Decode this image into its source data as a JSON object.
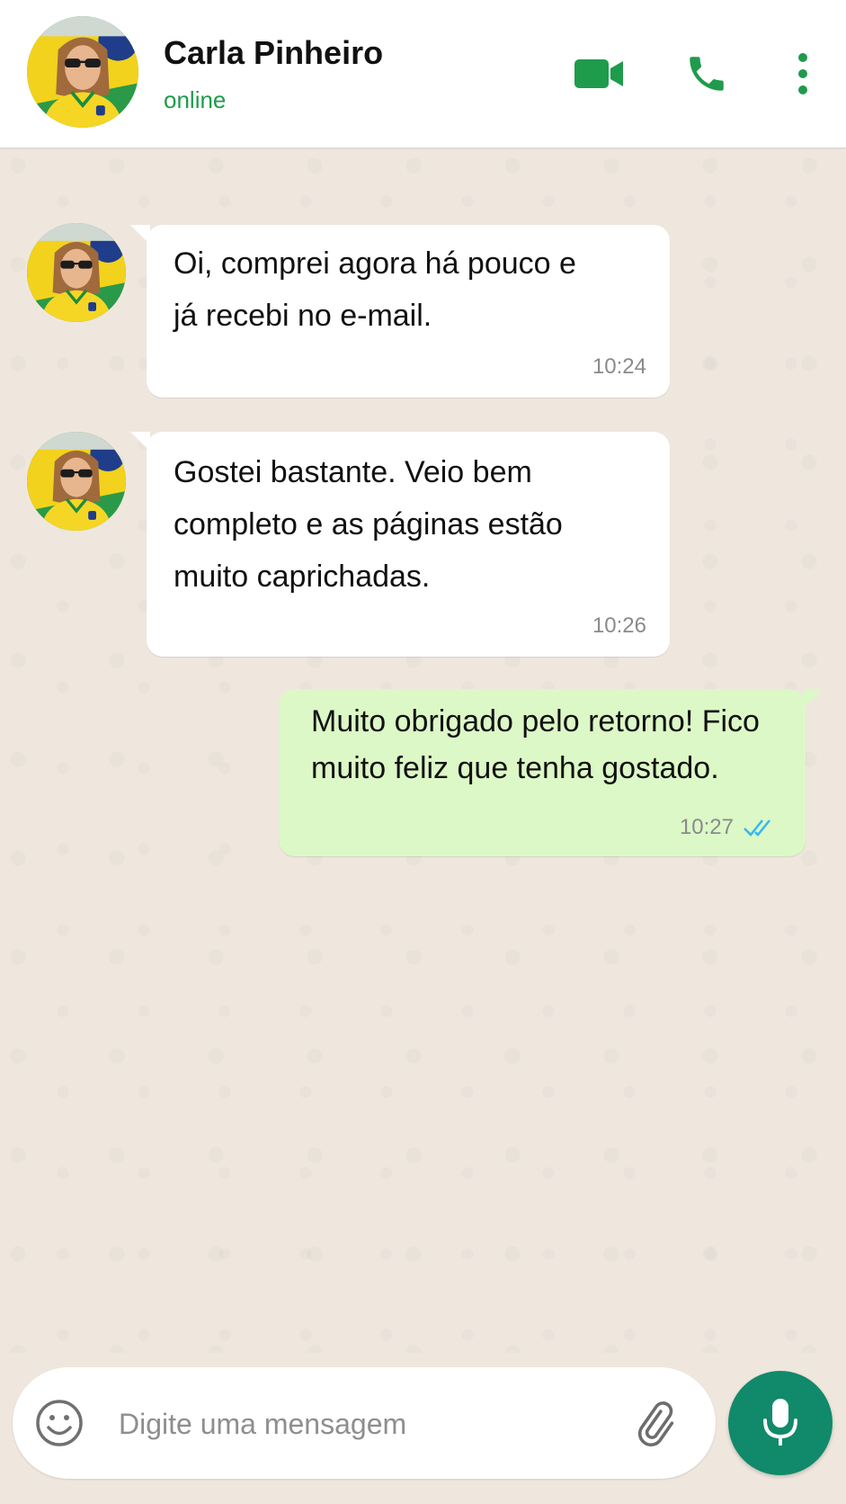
{
  "header": {
    "contact_name": "Carla Pinheiro",
    "status": "online",
    "icons": [
      "video-call-icon",
      "voice-call-icon",
      "more-options-icon"
    ]
  },
  "messages": [
    {
      "direction": "incoming",
      "text": "Oi, comprei agora há pouco e\njá recebi no e-mail.",
      "time": "10:24"
    },
    {
      "direction": "incoming",
      "text": "Gostei bastante. Veio bem\ncompleto e as páginas estão\nmuito caprichadas.",
      "time": "10:26"
    },
    {
      "direction": "outgoing",
      "text": "Muito obrigado pelo retorno! Fico\nmuito feliz que tenha gostado.",
      "time": "10:27",
      "status": "read"
    }
  ],
  "composer": {
    "placeholder": "Digite uma mensagem",
    "value": ""
  },
  "colors": {
    "accent": "#1f9b4c",
    "mic_button": "#108a6a",
    "outgoing_bubble": "#dcf8c6",
    "incoming_bubble": "#ffffff",
    "chat_background": "#efe7de",
    "read_ticks": "#34b7f1"
  }
}
